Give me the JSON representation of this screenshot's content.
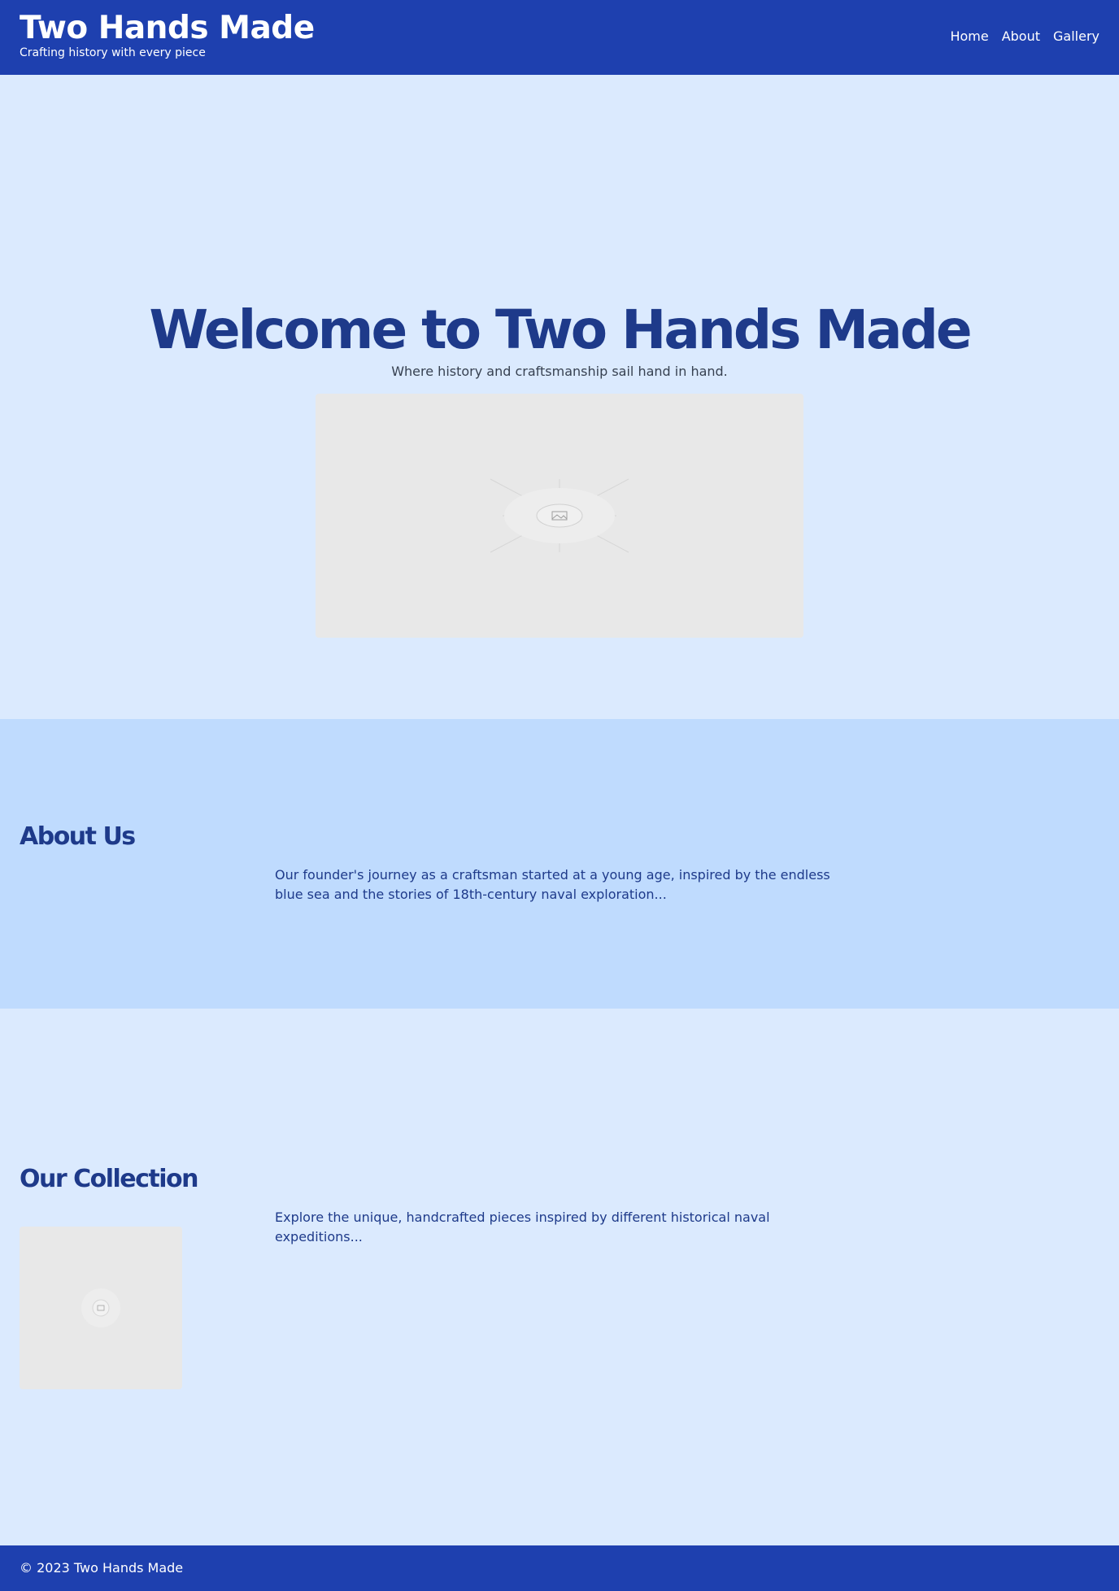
{
  "header": {
    "title": "Two Hands Made",
    "tagline": "Crafting history with every piece",
    "nav": [
      {
        "label": "Home"
      },
      {
        "label": "About"
      },
      {
        "label": "Gallery"
      }
    ]
  },
  "hero": {
    "title": "Welcome to Two Hands Made",
    "subtitle": "Where history and craftsmanship sail hand in hand.",
    "image_icon": "image-placeholder-icon"
  },
  "about": {
    "title": "About Us",
    "text": "Our founder's journey as a craftsman started at a young age, inspired by the endless blue sea and the stories of 18th-century naval exploration..."
  },
  "collection": {
    "title": "Our Collection",
    "text": "Explore the unique, handcrafted pieces inspired by different historical naval expeditions...",
    "item_icon": "image-placeholder-icon"
  },
  "footer": {
    "copyright": "© 2023 Two Hands Made"
  },
  "colors": {
    "header_bg": "#1e40af",
    "hero_bg": "#dbeafe",
    "about_bg": "#bfdbfe",
    "heading": "#1e3a8a",
    "placeholder_bg": "#e8e8e8"
  }
}
